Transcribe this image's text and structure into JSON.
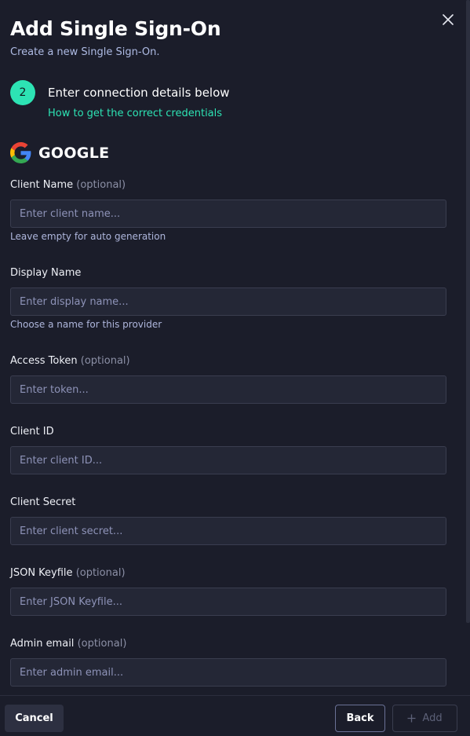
{
  "header": {
    "title": "Add Single Sign-On",
    "subtitle": "Create a new Single Sign-On.",
    "close_icon": "close-icon"
  },
  "step": {
    "number": "2",
    "title": "Enter connection details below",
    "link": "How to get the correct credentials",
    "link_color": "#2de3b4"
  },
  "provider": {
    "name": "GOOGLE",
    "logo_icon": "google-logo-icon"
  },
  "fields": {
    "client_name": {
      "label": "Client Name",
      "optional": "(optional)",
      "placeholder": "Enter client name...",
      "hint": "Leave empty for auto generation"
    },
    "display_name": {
      "label": "Display Name",
      "placeholder": "Enter display name...",
      "hint": "Choose a name for this provider"
    },
    "access_token": {
      "label": "Access Token",
      "optional": "(optional)",
      "placeholder": "Enter token..."
    },
    "client_id": {
      "label": "Client ID",
      "placeholder": "Enter client ID..."
    },
    "client_secret": {
      "label": "Client Secret",
      "placeholder": "Enter client secret..."
    },
    "json_keyfile": {
      "label": "JSON Keyfile",
      "optional": "(optional)",
      "placeholder": "Enter JSON Keyfile..."
    },
    "admin_email": {
      "label": "Admin email",
      "optional": "(optional)",
      "placeholder": "Enter admin email..."
    }
  },
  "footer": {
    "cancel_label": "Cancel",
    "back_label": "Back",
    "add_label": "Add",
    "add_icon": "plus-icon"
  },
  "colors": {
    "background": "#1b1d2a",
    "accent": "#2de3b4",
    "input_bg": "#242736"
  }
}
